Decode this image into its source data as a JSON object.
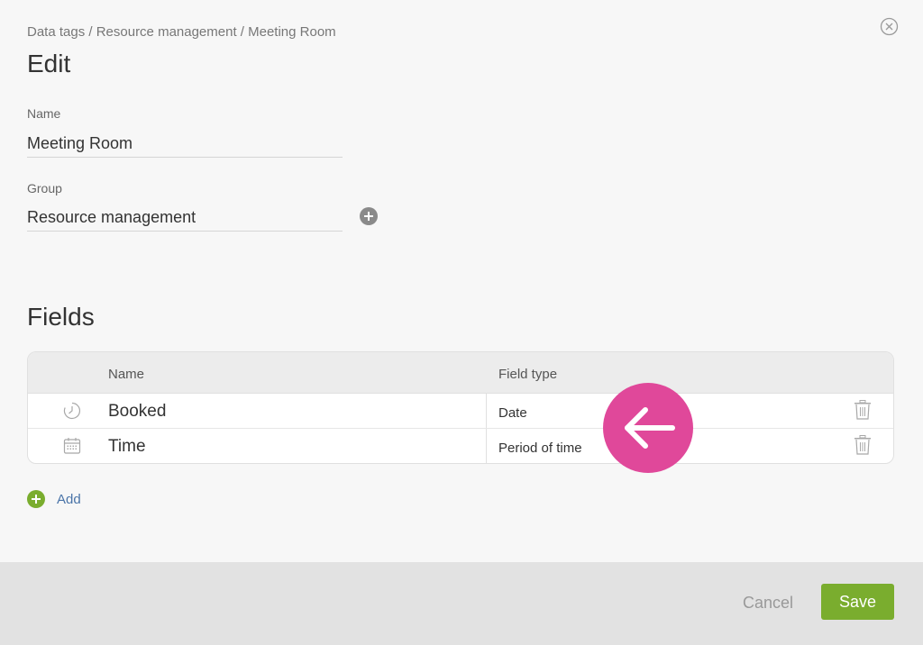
{
  "breadcrumb": "Data tags / Resource management / Meeting Room",
  "page_title": "Edit",
  "name_field": {
    "label": "Name",
    "value": "Meeting Room"
  },
  "group_field": {
    "label": "Group",
    "value": "Resource management"
  },
  "fields_section": {
    "title": "Fields",
    "columns": {
      "name": "Name",
      "field_type": "Field type"
    },
    "rows": [
      {
        "icon": "clock-icon",
        "name": "Booked",
        "type": "Date"
      },
      {
        "icon": "calendar-icon",
        "name": "Time",
        "type": "Period of time"
      }
    ],
    "add_label": "Add"
  },
  "footer": {
    "cancel_label": "Cancel",
    "save_label": "Save"
  },
  "colors": {
    "accent_green": "#7aad2e",
    "link_blue": "#4a74a8",
    "badge_pink": "#e0489a"
  },
  "icons": {
    "close": "close-circle-icon",
    "group_add": "plus-circle-icon",
    "add": "plus-circle-icon",
    "delete": "trash-icon",
    "badge": "arrow-left-icon"
  }
}
